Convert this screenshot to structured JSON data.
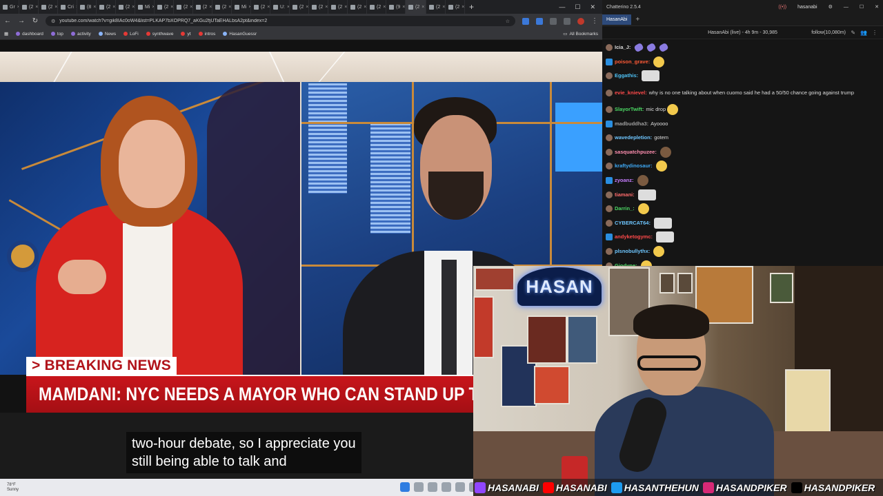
{
  "browser": {
    "tabs": [
      {
        "label": "Gr"
      },
      {
        "label": "(2"
      },
      {
        "label": "(2"
      },
      {
        "label": "Cri"
      },
      {
        "label": "(8"
      },
      {
        "label": "(2"
      },
      {
        "label": "(2"
      },
      {
        "label": "Mi"
      },
      {
        "label": "(2"
      },
      {
        "label": "(2"
      },
      {
        "label": "(2"
      },
      {
        "label": "(2"
      },
      {
        "label": "Mi"
      },
      {
        "label": "(2"
      },
      {
        "label": "U:"
      },
      {
        "label": "(2"
      },
      {
        "label": "(2"
      },
      {
        "label": "(2"
      },
      {
        "label": "(2"
      },
      {
        "label": "(2"
      },
      {
        "label": "(9"
      },
      {
        "label": "(2"
      },
      {
        "label": "(2"
      },
      {
        "label": "(2"
      }
    ],
    "active_tab_index": 21,
    "new_tab": "+",
    "url": "youtube.com/watch?v=gik8IAc0oW4&list=PLKAP7bXOPRQ7_aKGu2fjUTaEHALbsA2pt&index=2",
    "bookmarks": [
      "dashboard",
      "top",
      "activity",
      "News",
      "LoFi",
      "synthwave",
      "yt",
      "intros",
      "HasanGuessr"
    ],
    "all_bookmarks": "All Bookmarks",
    "nav_icons": {
      "back": "←",
      "forward": "→",
      "reload": "↻",
      "apps": "▦"
    }
  },
  "video": {
    "breaking_label": "> BREAKING NEWS",
    "headline": "MAMDANI: NYC NEEDS A MAYOR WHO CAN STAND UP TO TRUMP",
    "subtitle_line1": "two-hour debate, so I appreciate you",
    "subtitle_line2": "still being able to talk and"
  },
  "taskbar": {
    "temperature": "78°F",
    "condition": "Sunny"
  },
  "chatterino": {
    "app_title": "Chatterino 2.5.4",
    "username": "hasanabi",
    "tab": "HasanAbi",
    "add_tab": "+",
    "stream_info": "HasanAbi (live) - 4h 9m - 30,985",
    "follow_mode": "follow(10,080m)",
    "messages": [
      {
        "nick": "Icia_J:",
        "color": "#d8d8d8",
        "text": "",
        "emotes": [
          "pill",
          "pill",
          "pill"
        ]
      },
      {
        "nick": "poison_grave:",
        "color": "#ff5a36",
        "text": "",
        "emotes": [
          "face"
        ]
      },
      {
        "nick": "Eggathis:",
        "color": "#4fc3f7",
        "text": "",
        "emotes": [
          "wide"
        ]
      },
      {
        "nick": "evie_knievel:",
        "color": "#ff4a4a",
        "text": "why is no one talking about when cuomo said he had a 50/50 chance going against trump",
        "emotes": []
      },
      {
        "nick": "SlayorTwift:",
        "color": "#4cd964",
        "text": "mic drop",
        "emotes": [
          "face"
        ]
      },
      {
        "nick": "madbuddha3:",
        "color": "#9e9e9e",
        "text": "Ayoooo",
        "emotes": []
      },
      {
        "nick": "wavedepletion:",
        "color": "#6ec6ff",
        "text": "gotem",
        "emotes": []
      },
      {
        "nick": "sasquatchpuzee:",
        "color": "#ff8fb0",
        "text": "",
        "emotes": [
          "dark"
        ]
      },
      {
        "nick": "kraftydinosaur:",
        "color": "#3fa9f5",
        "text": "",
        "emotes": [
          "face"
        ]
      },
      {
        "nick": "zyoanz:",
        "color": "#c77dff",
        "text": "",
        "emotes": [
          "dark"
        ]
      },
      {
        "nick": "tiamani:",
        "color": "#ff6b6b",
        "text": "",
        "emotes": [
          "wide"
        ]
      },
      {
        "nick": "Darrin_:",
        "color": "#4cd964",
        "text": "",
        "emotes": [
          "face"
        ]
      },
      {
        "nick": "CYBERCAT64:",
        "color": "#6ec6ff",
        "text": "",
        "emotes": [
          "wide"
        ]
      },
      {
        "nick": "andyketogymc:",
        "color": "#ff4a4a",
        "text": "",
        "emotes": [
          "wide"
        ]
      },
      {
        "nick": "plsnobullythx:",
        "color": "#6ec6ff",
        "text": "",
        "emotes": [
          "face"
        ]
      },
      {
        "nick": "Giodyne:",
        "color": "#4cd964",
        "text": "",
        "emotes": [
          "face"
        ]
      }
    ]
  },
  "webcam": {
    "neon_sign": "HASAN",
    "socials": [
      {
        "handle": "HASANABI",
        "logo_color": "#9146ff",
        "icon": "twitch-icon"
      },
      {
        "handle": "HASANABI",
        "logo_color": "#ff0000",
        "icon": "youtube-icon"
      },
      {
        "handle": "HASANTHEHUN",
        "logo_color": "#1d9bf0",
        "icon": "twitter-icon"
      },
      {
        "handle": "HASANDPIKER",
        "logo_color": "#d62976",
        "icon": "instagram-icon"
      },
      {
        "handle": "HASANDPIKER",
        "logo_color": "#000000",
        "icon": "tiktok-icon"
      }
    ]
  }
}
